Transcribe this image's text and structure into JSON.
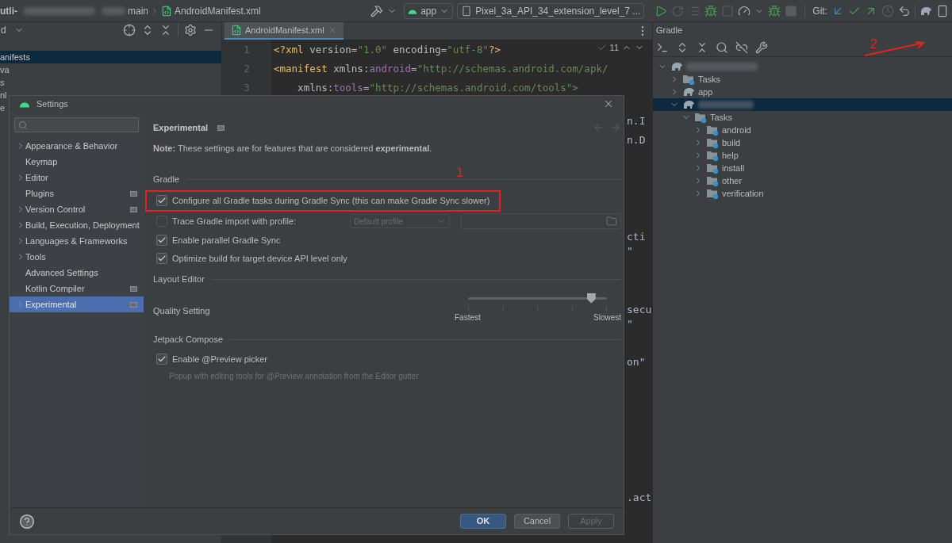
{
  "top_bar": {
    "breadcrumbs": [
      "utli-",
      "main",
      "AndroidManifest.xml"
    ],
    "run_config": "app",
    "device": "Pixel_3a_API_34_extension_level_7 ...",
    "vcs_label": "Git:"
  },
  "project_panel": {
    "view_label": "d",
    "tree": [
      {
        "label": "anifests",
        "selected": true
      },
      {
        "label": "va",
        "selected": false
      },
      {
        "label": "s",
        "selected": false
      },
      {
        "label": "nl",
        "selected": false
      },
      {
        "label": "e",
        "selected": false
      }
    ]
  },
  "editor": {
    "tab": "AndroidManifest.xml",
    "inspection_count": "11",
    "lines": [
      {
        "number": "1",
        "tokens": [
          {
            "kind": "tag",
            "text": "<?xml "
          },
          {
            "kind": "attr",
            "text": "version="
          },
          {
            "kind": "value",
            "text": "\"1.0\" "
          },
          {
            "kind": "attr",
            "text": "encoding="
          },
          {
            "kind": "value",
            "text": "\"utf-8\""
          },
          {
            "kind": "tag",
            "text": "?>"
          }
        ]
      },
      {
        "number": "2",
        "tokens": [
          {
            "kind": "tag",
            "text": "<manifest "
          },
          {
            "kind": "attr",
            "text": "xmlns:"
          },
          {
            "kind": "ns",
            "text": "android"
          },
          {
            "kind": "attr",
            "text": "="
          },
          {
            "kind": "value",
            "text": "\"http://schemas.android.com/apk/"
          }
        ]
      },
      {
        "number": "3",
        "tokens": [
          {
            "kind": "attr",
            "text": "    xmlns:"
          },
          {
            "kind": "ns",
            "text": "tools"
          },
          {
            "kind": "attr",
            "text": "="
          },
          {
            "kind": "value",
            "text": "\"http://schemas.android.com/tools\">"
          }
        ]
      }
    ],
    "fragments": [
      "n.I",
      "n.D",
      "cti",
      "\"",
      "secu",
      "\"",
      "on\"",
      ".act"
    ]
  },
  "settings": {
    "title": "Settings",
    "nav": [
      {
        "label": "Appearance & Behavior",
        "expandable": true,
        "project_level": false,
        "selected": false
      },
      {
        "label": "Keymap",
        "expandable": false,
        "project_level": false,
        "selected": false
      },
      {
        "label": "Editor",
        "expandable": true,
        "project_level": false,
        "selected": false
      },
      {
        "label": "Plugins",
        "expandable": false,
        "project_level": true,
        "selected": false
      },
      {
        "label": "Version Control",
        "expandable": true,
        "project_level": true,
        "selected": false
      },
      {
        "label": "Build, Execution, Deployment",
        "expandable": true,
        "project_level": false,
        "selected": false
      },
      {
        "label": "Languages & Frameworks",
        "expandable": true,
        "project_level": false,
        "selected": false
      },
      {
        "label": "Tools",
        "expandable": true,
        "project_level": false,
        "selected": false
      },
      {
        "label": "Advanced Settings",
        "expandable": false,
        "project_level": false,
        "selected": false
      },
      {
        "label": "Kotlin Compiler",
        "expandable": false,
        "project_level": true,
        "selected": false
      },
      {
        "label": "Experimental",
        "expandable": true,
        "project_level": true,
        "selected": true
      }
    ],
    "page_title": "Experimental",
    "note": "**Note:** These settings are for features that are considered **experimental**.",
    "sections": [
      {
        "title": "Gradle",
        "rows": [
          {
            "kind": "checkbox",
            "label": "Configure all Gradle tasks during Gradle Sync (this can make Gradle Sync slower)",
            "checked": true,
            "callout": "1"
          },
          {
            "kind": "profile",
            "label": "Trace Gradle import with profile:",
            "checked": false,
            "dropdown": "Default profile",
            "disabled": true
          },
          {
            "kind": "checkbox",
            "label": "Enable parallel Gradle Sync",
            "checked": true
          },
          {
            "kind": "checkbox",
            "label": "Optimize build for target device API level only",
            "checked": true
          }
        ]
      },
      {
        "title": "Layout Editor",
        "rows": [
          {
            "kind": "slider",
            "label": "Quality Setting",
            "level": 0.89,
            "min_label": "Fastest",
            "max_label": "Slowest"
          }
        ]
      },
      {
        "title": "Jetpack Compose",
        "rows": [
          {
            "kind": "checkbox",
            "label": "Enable @Preview picker",
            "checked": true,
            "description": "Popup with editing tools for @Preview annotation from the Editor gutter"
          }
        ]
      }
    ],
    "buttons": [
      {
        "label": "OK",
        "kind": "primary"
      },
      {
        "label": "Cancel",
        "kind": "normal"
      },
      {
        "label": "Apply",
        "kind": "disabled"
      }
    ]
  },
  "gradle_panel": {
    "title": "Gradle",
    "sync_callout": "2",
    "tree": [
      {
        "kind": "project",
        "expanded": true,
        "selected": false,
        "children": [
          {
            "kind": "tasks",
            "label": "Tasks",
            "expanded": false,
            "selected": false
          },
          {
            "kind": "module",
            "label": "app",
            "expanded": false,
            "selected": false
          },
          {
            "kind": "module",
            "expanded": true,
            "selected": true,
            "children": [
              {
                "kind": "tasks",
                "label": "Tasks",
                "expanded": true,
                "selected": false,
                "children": [
                  {
                    "kind": "tasks",
                    "label": "android",
                    "expanded": false,
                    "selected": false
                  },
                  {
                    "kind": "tasks",
                    "label": "build",
                    "expanded": false,
                    "selected": false
                  },
                  {
                    "kind": "tasks",
                    "label": "help",
                    "expanded": false,
                    "selected": false
                  },
                  {
                    "kind": "tasks",
                    "label": "install",
                    "expanded": false,
                    "selected": false
                  },
                  {
                    "kind": "tasks",
                    "label": "other",
                    "expanded": false,
                    "selected": false
                  },
                  {
                    "kind": "tasks",
                    "label": "verification",
                    "expanded": false,
                    "selected": false
                  }
                ]
              }
            ]
          }
        ]
      }
    ]
  }
}
